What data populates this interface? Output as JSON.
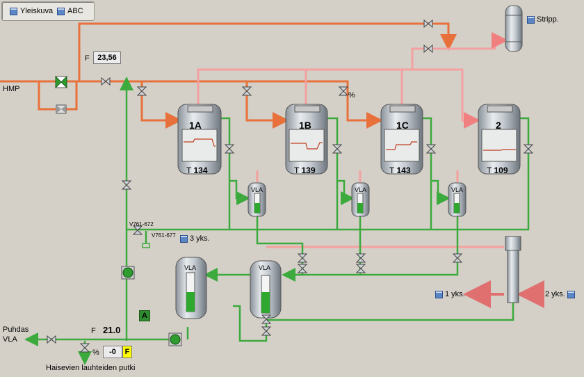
{
  "nav": {
    "tab1": "Yleiskuva",
    "tab2": "ABC"
  },
  "labels": {
    "hmp": "HMP",
    "stripp": "Stripp.",
    "flow_f_top": "F",
    "flow_top_value": "23,56",
    "percent_mid": "%",
    "valve_v761_672": "V761-672",
    "valve_v761_677": "V761-677",
    "yks3": "3 yks.",
    "yks1": "1 yks.",
    "yks2": "2 yks.",
    "puhdas": "Puhdas",
    "vla_out": "VLA",
    "flow_f_bottom": "F",
    "flow_bottom_value": "21.0",
    "percent_bottom": "%",
    "bottom_value": "-0",
    "bottom_f_badge": "F",
    "mode_badge": "A",
    "drain_caption": "Haisevien lauhteiden putki"
  },
  "tanks": [
    {
      "name": "1A",
      "t_label": "T",
      "t_value": "134"
    },
    {
      "name": "1B",
      "t_label": "T",
      "t_value": "139"
    },
    {
      "name": "1C",
      "t_label": "T",
      "t_value": "143"
    },
    {
      "name": "2",
      "t_label": "T",
      "t_value": "109"
    }
  ],
  "vessels": {
    "small_vla_1": "VLA",
    "small_vla_2": "VLA",
    "small_vla_3": "VLA",
    "big_vla_left": "VLA",
    "big_vla_right": "VLA"
  },
  "colors": {
    "steam_pipe": "#e8703a",
    "pink_pipe": "#f4a0a0",
    "condensate_pipe": "#3caa3c",
    "background": "#d4d0c8",
    "nav_icon": "#5a86c6",
    "badge_yellow": "#ffff00",
    "badge_green": "#2e8b2e"
  },
  "icons": [
    "layout-icon",
    "valve-icon",
    "pump-icon",
    "arrow-icon"
  ]
}
